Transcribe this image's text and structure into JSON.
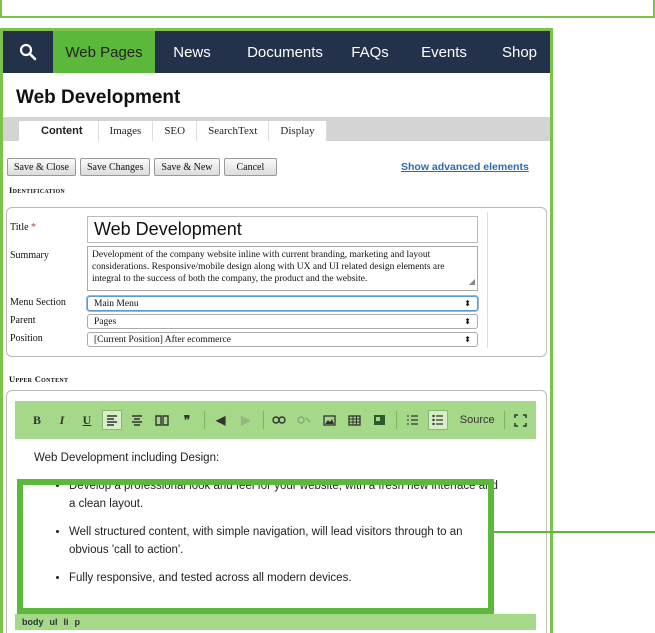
{
  "nav": {
    "items": [
      "Web Pages",
      "News",
      "Documents",
      "FAQs",
      "Events",
      "Shop"
    ],
    "active": "Web Pages"
  },
  "page_title": "Web Development",
  "tabs": [
    "Content",
    "Images",
    "SEO",
    "SearchText",
    "Display"
  ],
  "actions": {
    "save_close": "Save & Close",
    "save_changes": "Save Changes",
    "save_new": "Save & New",
    "cancel": "Cancel",
    "advanced": "Show advanced elements"
  },
  "identification": {
    "label": "Identification",
    "title_label": "Title",
    "required_mark": "*",
    "title_value": "Web Development",
    "summary_label": "Summary",
    "summary_value": "Development of the company website inline with current branding, marketing and layout considerations. Responsive/mobile design along with UX and UI related design elements are integral to the success of both the company, the product and the website.",
    "menu_section_label": "Menu Section",
    "menu_section_value": "Main Menu",
    "parent_label": "Parent",
    "parent_value": "Pages",
    "position_label": "Position",
    "position_value": "[Current Position] After ecommerce"
  },
  "upper_content": {
    "label": "Upper Content",
    "source_label": "Source",
    "intro": "Web Development including Design:",
    "bullets": [
      "Develop a professional look and feel for your website, with a fresh new interface and a clean layout.",
      "Well structured content, with simple navigation, will lead visitors through to an obvious 'call to action'.",
      "Fully responsive, and tested across all modern devices."
    ],
    "path": [
      "body",
      "ul",
      "li",
      "p"
    ]
  },
  "colors": {
    "accent_green": "#5cb83a",
    "nav_bg": "#23324a",
    "toolbar_green": "#a5d889",
    "link_blue": "#2a6bb0"
  }
}
